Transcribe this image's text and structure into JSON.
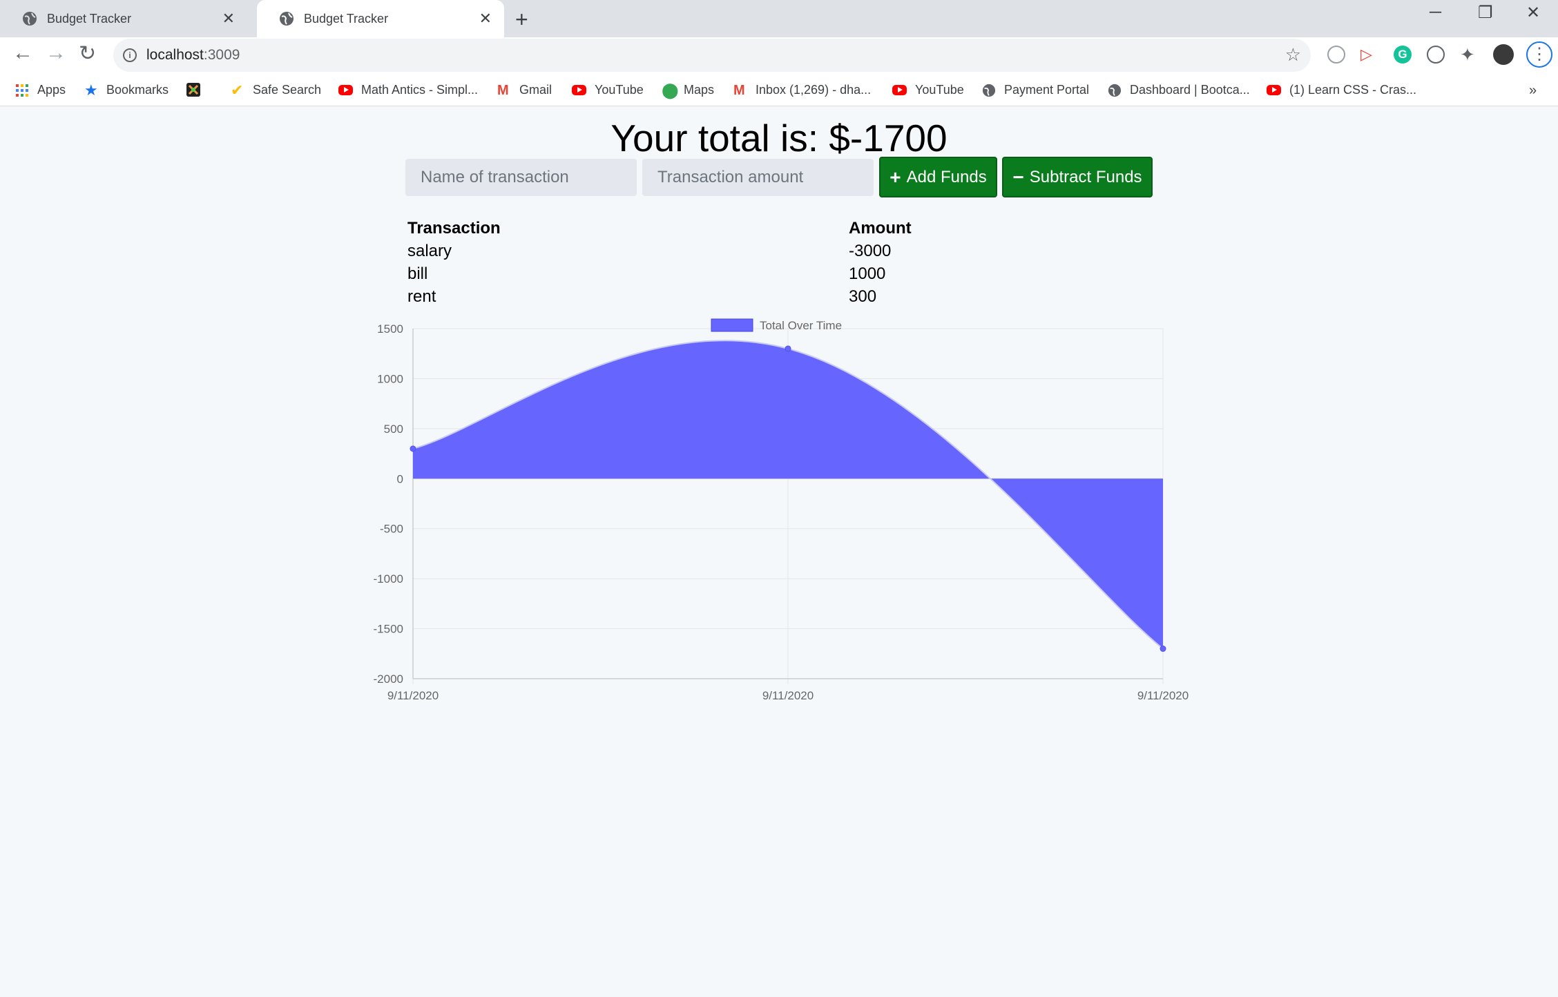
{
  "browser": {
    "tabs": [
      {
        "title": "Budget Tracker",
        "active": false
      },
      {
        "title": "Budget Tracker",
        "active": true
      }
    ],
    "url_host": "localhost",
    "url_port": ":3009",
    "bookmarks": [
      {
        "label": "Apps",
        "icon": "apps-grid-icon"
      },
      {
        "label": "Bookmarks",
        "icon": "star-icon"
      },
      {
        "label": "",
        "icon": "app-logo-icon"
      },
      {
        "label": "Safe Search",
        "icon": "safe-search-icon"
      },
      {
        "label": "Math Antics - Simpl...",
        "icon": "youtube-icon"
      },
      {
        "label": "Gmail",
        "icon": "gmail-icon"
      },
      {
        "label": "YouTube",
        "icon": "youtube-icon"
      },
      {
        "label": "Maps",
        "icon": "maps-icon"
      },
      {
        "label": "Inbox (1,269) - dha...",
        "icon": "gmail-icon"
      },
      {
        "label": "YouTube",
        "icon": "youtube-icon"
      },
      {
        "label": "Payment Portal",
        "icon": "globe-icon"
      },
      {
        "label": "Dashboard | Bootca...",
        "icon": "globe-icon"
      },
      {
        "label": "(1) Learn CSS - Cras...",
        "icon": "youtube-icon"
      }
    ],
    "overflow": "»"
  },
  "app": {
    "total_text": "Your total is: $-1700",
    "name_placeholder": "Name of transaction",
    "amount_placeholder": "Transaction amount",
    "add_label": "Add Funds",
    "subtract_label": "Subtract Funds",
    "add_icon": "+",
    "subtract_icon": "−",
    "button_color": "#0b7c1e",
    "table": {
      "headers": [
        "Transaction",
        "Amount"
      ],
      "rows": [
        [
          "salary",
          "-3000"
        ],
        [
          "bill",
          "1000"
        ],
        [
          "rent",
          "300"
        ]
      ]
    }
  },
  "chart_data": {
    "type": "area",
    "legend": "Total Over Time",
    "legend_position": "top",
    "color": "#6666ff",
    "x": [
      "9/11/2020",
      "9/11/2020",
      "9/11/2020"
    ],
    "series": [
      {
        "name": "Total Over Time",
        "values": [
          300,
          1300,
          -1700
        ]
      }
    ],
    "ylim": [
      -2000,
      1500
    ],
    "yticks": [
      1500,
      1000,
      500,
      0,
      -500,
      -1000,
      -1500,
      -2000
    ],
    "grid": true
  }
}
